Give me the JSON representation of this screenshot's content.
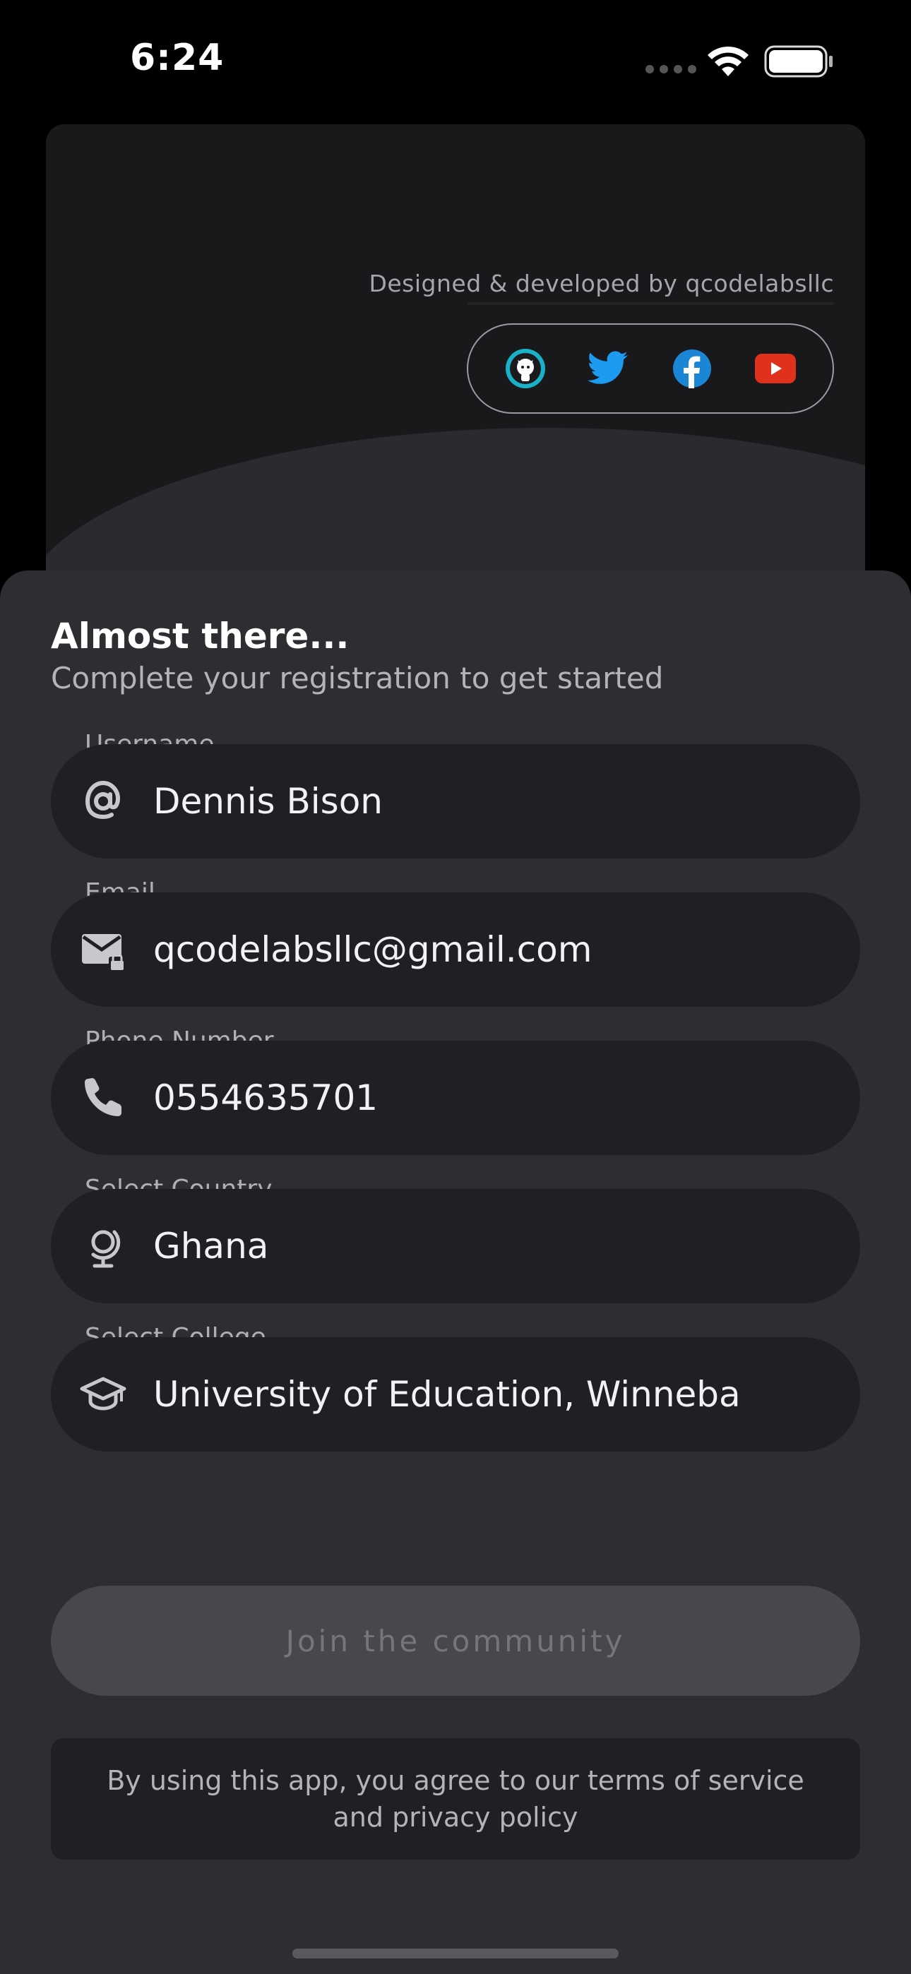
{
  "status_bar": {
    "time": "6:24"
  },
  "header": {
    "credit": "Designed & developed by qcodelabsllc",
    "social": [
      {
        "name": "github-icon",
        "color": "#19b0c8"
      },
      {
        "name": "twitter-icon",
        "color": "#1d9bf0"
      },
      {
        "name": "facebook-icon",
        "color": "#1b86d6"
      },
      {
        "name": "youtube-icon",
        "color": "#e0311c"
      }
    ]
  },
  "sheet": {
    "title": "Almost there...",
    "subtitle": "Complete your registration to get started",
    "fields": [
      {
        "label": "Username",
        "value": "Dennis Bison",
        "icon": "at-icon"
      },
      {
        "label": "Email",
        "value": "qcodelabsllc@gmail.com",
        "icon": "email-lock-icon"
      },
      {
        "label": "Phone Number",
        "value": "0554635701",
        "icon": "phone-icon"
      },
      {
        "label": "Select Country",
        "value": "Ghana",
        "icon": "globe-icon"
      },
      {
        "label": "Select College",
        "value": "University of Education, Winneba",
        "icon": "graduation-cap-icon"
      }
    ],
    "join_label": "Join the community",
    "terms": "By using this app, you agree to our terms of service and privacy policy"
  }
}
